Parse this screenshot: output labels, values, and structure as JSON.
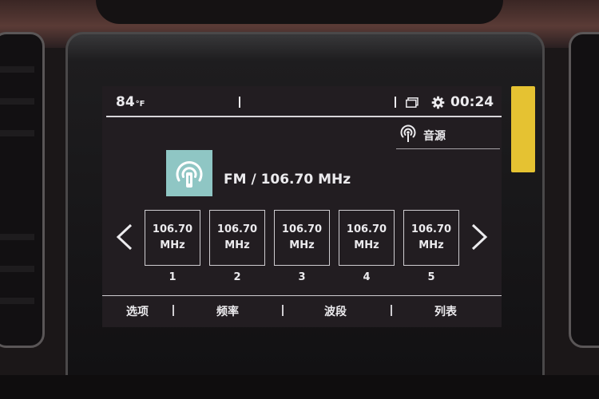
{
  "status_bar": {
    "temperature": "84",
    "temperature_unit": "°F",
    "time": "00:24"
  },
  "source": {
    "label": "音源"
  },
  "now_playing": {
    "label": "FM / 106.70 MHz"
  },
  "presets": [
    {
      "freq": "106.70",
      "unit": "MHz",
      "number": "1"
    },
    {
      "freq": "106.70",
      "unit": "MHz",
      "number": "2"
    },
    {
      "freq": "106.70",
      "unit": "MHz",
      "number": "3"
    },
    {
      "freq": "106.70",
      "unit": "MHz",
      "number": "4"
    },
    {
      "freq": "106.70",
      "unit": "MHz",
      "number": "5"
    }
  ],
  "tabs": [
    {
      "label": "选项"
    },
    {
      "label": "频率"
    },
    {
      "label": "波段"
    },
    {
      "label": "列表"
    }
  ],
  "icons": {
    "source": "radio-broadcast-icon",
    "station_art": "radio-broadcast-icon",
    "prev": "chevron-left-icon",
    "next": "chevron-right-icon",
    "settings": "gear-icon",
    "screen": "screen-stack-icon"
  },
  "colors": {
    "screen_bg": "#221d21",
    "text": "#ecebee",
    "station_art_bg": "#8fc6c4",
    "yellow_tab": "#e5c232"
  }
}
